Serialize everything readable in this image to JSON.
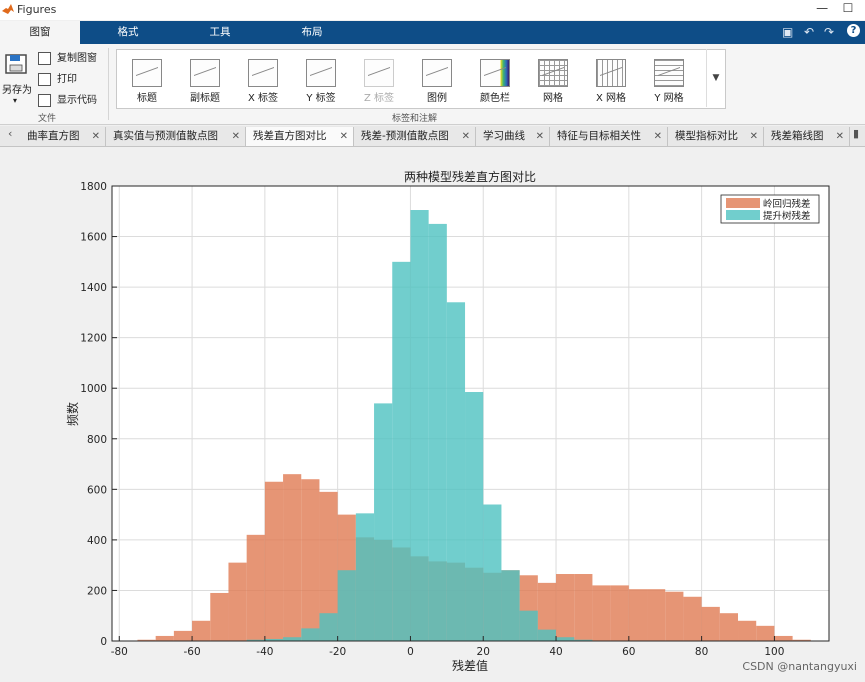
{
  "window": {
    "title": "Figures",
    "controls": [
      "—",
      "☐"
    ]
  },
  "ribbon_tabs": [
    {
      "label": "图窗",
      "active": true
    },
    {
      "label": "格式",
      "active": false
    },
    {
      "label": "工具",
      "active": false
    },
    {
      "label": "布局",
      "active": false
    }
  ],
  "file_group": {
    "save_as": "另存为",
    "copy_figure": "复制图窗",
    "print": "打印",
    "show_code": "显示代码",
    "label": "文件"
  },
  "gallery": {
    "label": "标签和注解",
    "items": [
      {
        "label": "标题",
        "icon": "title-icon",
        "enabled": true
      },
      {
        "label": "副标题",
        "icon": "subtitle-icon",
        "enabled": true
      },
      {
        "label": "X 标签",
        "icon": "xlabel-icon",
        "enabled": true
      },
      {
        "label": "Y 标签",
        "icon": "ylabel-icon",
        "enabled": true
      },
      {
        "label": "Z 标签",
        "icon": "zlabel-icon",
        "enabled": false
      },
      {
        "label": "图例",
        "icon": "legend-icon",
        "enabled": true
      },
      {
        "label": "颜色栏",
        "icon": "colorbar-icon",
        "enabled": true
      },
      {
        "label": "网格",
        "icon": "grid-icon",
        "enabled": true
      },
      {
        "label": "X 网格",
        "icon": "xgrid-icon",
        "enabled": true
      },
      {
        "label": "Y 网格",
        "icon": "ygrid-icon",
        "enabled": true
      }
    ]
  },
  "doc_tabs": [
    {
      "label": "曲率直方图",
      "active": false
    },
    {
      "label": "真实值与预测值散点图",
      "active": false
    },
    {
      "label": "残差直方图对比",
      "active": true
    },
    {
      "label": "残差-预测值散点图",
      "active": false
    },
    {
      "label": "学习曲线",
      "active": false
    },
    {
      "label": "特征与目标相关性",
      "active": false
    },
    {
      "label": "模型指标对比",
      "active": false
    },
    {
      "label": "残差箱线图",
      "active": false
    }
  ],
  "colors": {
    "ridge": "#e07a52",
    "boost": "#4ec2c0",
    "ribbon_dark": "#0e4d87"
  },
  "watermark": "CSDN @nantangyuxi",
  "chart_data": {
    "type": "bar",
    "title": "两种模型残差直方图对比",
    "xlabel": "残差值",
    "ylabel": "频数",
    "xlim": [
      -82,
      115
    ],
    "ylim": [
      0,
      1800
    ],
    "xticks": [
      -80,
      -60,
      -40,
      -20,
      0,
      20,
      40,
      60,
      80,
      100
    ],
    "yticks": [
      0,
      200,
      400,
      600,
      800,
      1000,
      1200,
      1400,
      1600,
      1800
    ],
    "grid": true,
    "legend_position": "top-right",
    "series": [
      {
        "name": "岭回归残差",
        "color": "#e07a52",
        "bins": [
          [
            -75,
            -70,
            5
          ],
          [
            -70,
            -65,
            20
          ],
          [
            -65,
            -60,
            40
          ],
          [
            -60,
            -55,
            80
          ],
          [
            -55,
            -50,
            190
          ],
          [
            -50,
            -45,
            310
          ],
          [
            -45,
            -40,
            420
          ],
          [
            -40,
            -35,
            630
          ],
          [
            -35,
            -30,
            660
          ],
          [
            -30,
            -25,
            640
          ],
          [
            -25,
            -20,
            590
          ],
          [
            -20,
            -15,
            500
          ],
          [
            -15,
            -10,
            410
          ],
          [
            -10,
            -5,
            400
          ],
          [
            -5,
            0,
            370
          ],
          [
            0,
            5,
            335
          ],
          [
            5,
            10,
            315
          ],
          [
            10,
            15,
            310
          ],
          [
            15,
            20,
            290
          ],
          [
            20,
            25,
            270
          ],
          [
            25,
            30,
            280
          ],
          [
            30,
            35,
            260
          ],
          [
            35,
            40,
            230
          ],
          [
            40,
            45,
            265
          ],
          [
            45,
            50,
            265
          ],
          [
            50,
            55,
            220
          ],
          [
            55,
            60,
            220
          ],
          [
            60,
            65,
            205
          ],
          [
            65,
            70,
            205
          ],
          [
            70,
            75,
            195
          ],
          [
            75,
            80,
            175
          ],
          [
            80,
            85,
            135
          ],
          [
            85,
            90,
            110
          ],
          [
            90,
            95,
            80
          ],
          [
            95,
            100,
            60
          ],
          [
            100,
            105,
            20
          ],
          [
            105,
            110,
            5
          ]
        ]
      },
      {
        "name": "提升树残差",
        "color": "#4ec2c0",
        "bins": [
          [
            -45,
            -40,
            5
          ],
          [
            -40,
            -35,
            8
          ],
          [
            -35,
            -30,
            15
          ],
          [
            -30,
            -25,
            50
          ],
          [
            -25,
            -20,
            110
          ],
          [
            -20,
            -15,
            280
          ],
          [
            -15,
            -10,
            505
          ],
          [
            -10,
            -5,
            940
          ],
          [
            -5,
            0,
            1500
          ],
          [
            0,
            5,
            1705
          ],
          [
            5,
            10,
            1650
          ],
          [
            10,
            15,
            1340
          ],
          [
            15,
            20,
            985
          ],
          [
            20,
            25,
            540
          ],
          [
            25,
            30,
            280
          ],
          [
            30,
            35,
            120
          ],
          [
            35,
            40,
            45
          ],
          [
            40,
            45,
            15
          ],
          [
            45,
            50,
            5
          ]
        ]
      }
    ]
  }
}
